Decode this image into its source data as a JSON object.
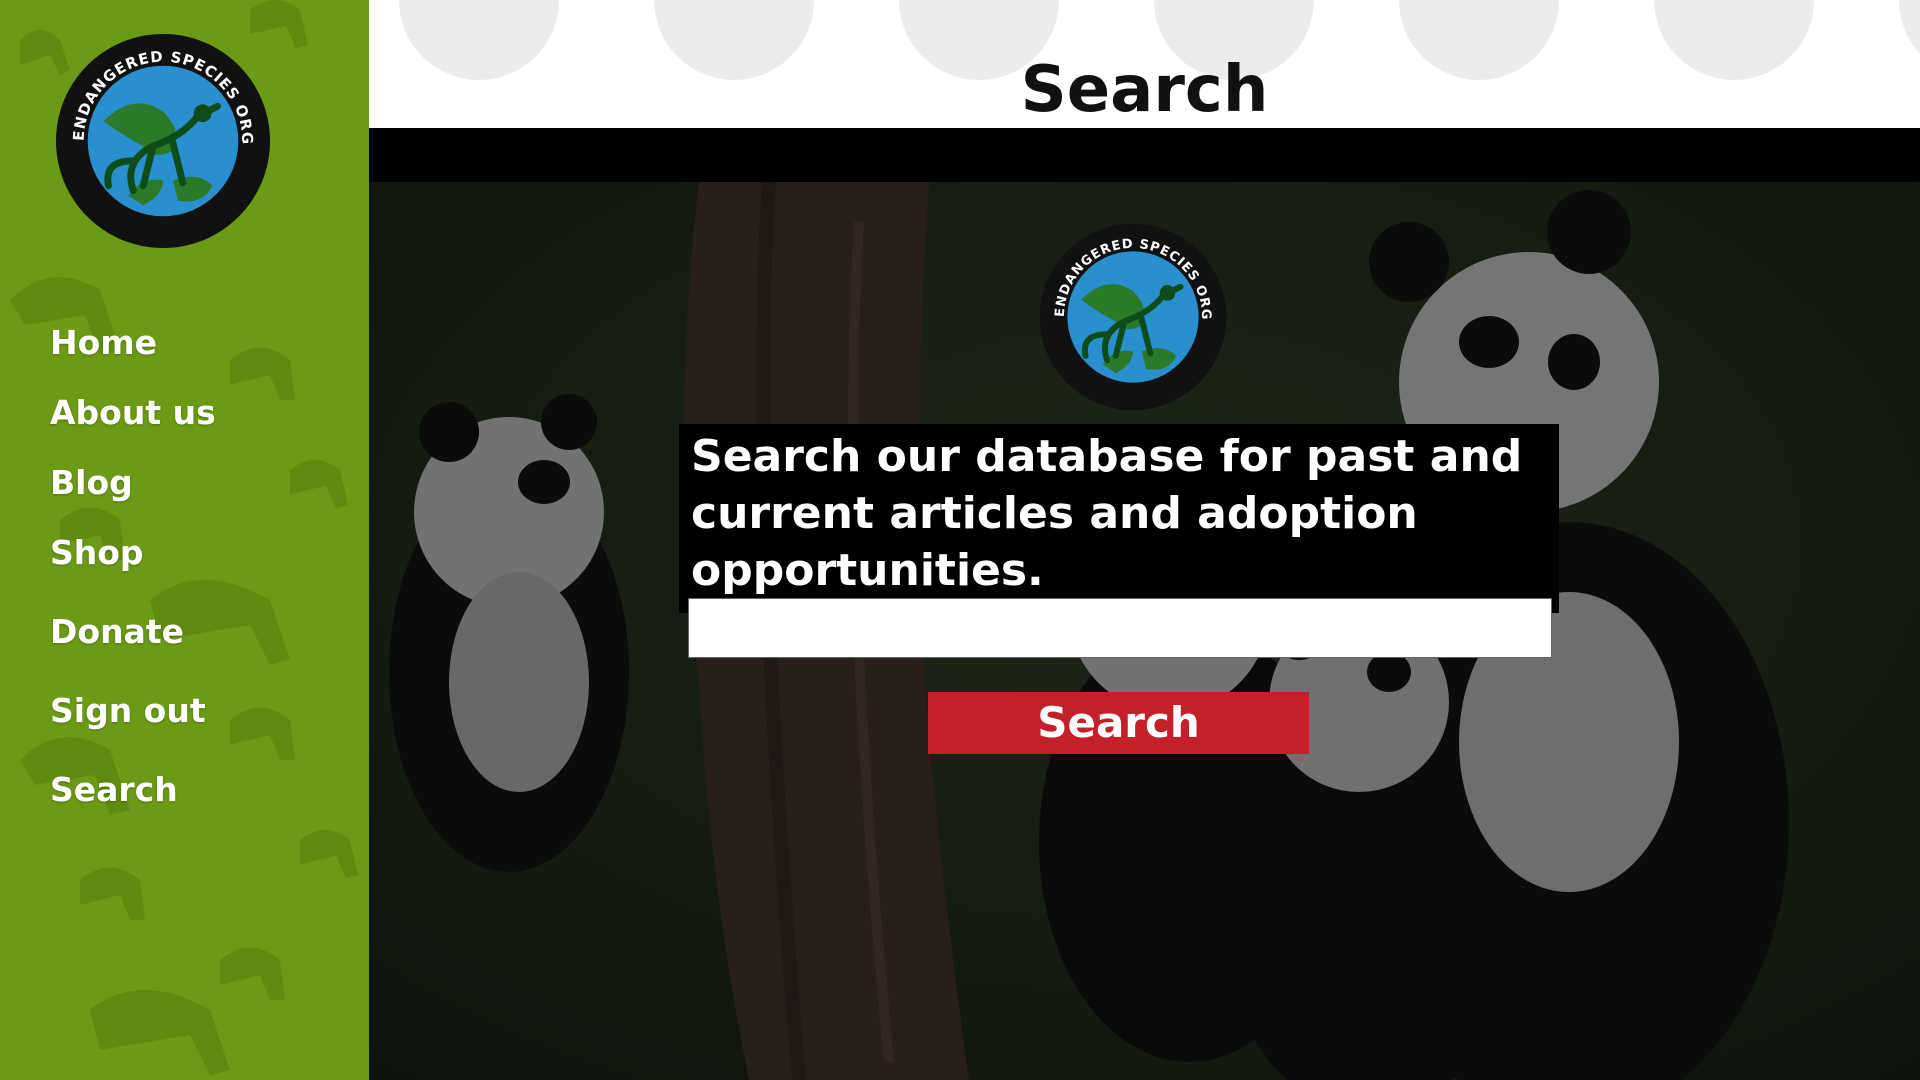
{
  "sidebar": {
    "logo": {
      "text": "ENDANGERED SPECIES ORGANIZATION",
      "icon": "monkey-globe-logo"
    },
    "nav": [
      {
        "label": "Home"
      },
      {
        "label": "About us"
      },
      {
        "label": "Blog"
      },
      {
        "label": "Shop"
      },
      {
        "label": "Donate"
      },
      {
        "label": "Sign out"
      },
      {
        "label": "Search"
      }
    ],
    "background_color": "#6b9a16"
  },
  "header": {
    "title": "Search"
  },
  "hero": {
    "logo_text": "ENDANGERED SPECIES ORGANIZATION",
    "tagline": "Search our database for past and current articles and adoption opportunities.",
    "search": {
      "value": "",
      "placeholder": ""
    },
    "search_button_label": "Search",
    "button_color": "#c4202a"
  }
}
